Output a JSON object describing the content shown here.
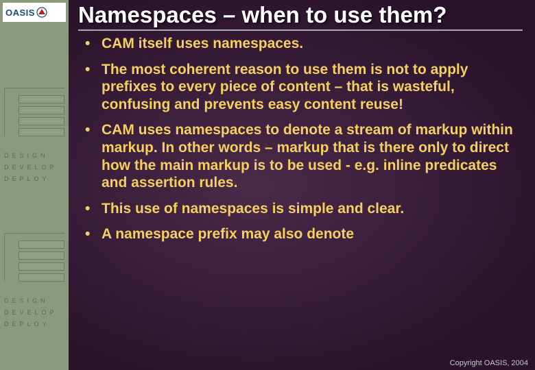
{
  "logo": {
    "text": "OASIS"
  },
  "sidebar": {
    "words": [
      "DESIGN",
      "DEVELOP",
      "DEPLOY"
    ]
  },
  "slide": {
    "title": "Namespaces – when to use them?",
    "bullets": [
      "CAM itself uses namespaces.",
      "The most coherent reason to use them is not to apply prefixes to every piece of content – that is wasteful, confusing and prevents easy content reuse!",
      "CAM uses namespaces to denote a stream of markup within markup.  In other words – markup that is there only to direct how the main markup is to be used  - e.g. inline predicates and assertion rules.",
      "This use of namespaces is simple and clear.",
      "A namespace prefix may also denote"
    ]
  },
  "footer": {
    "copyright": "Copyright OASIS, 2004"
  }
}
